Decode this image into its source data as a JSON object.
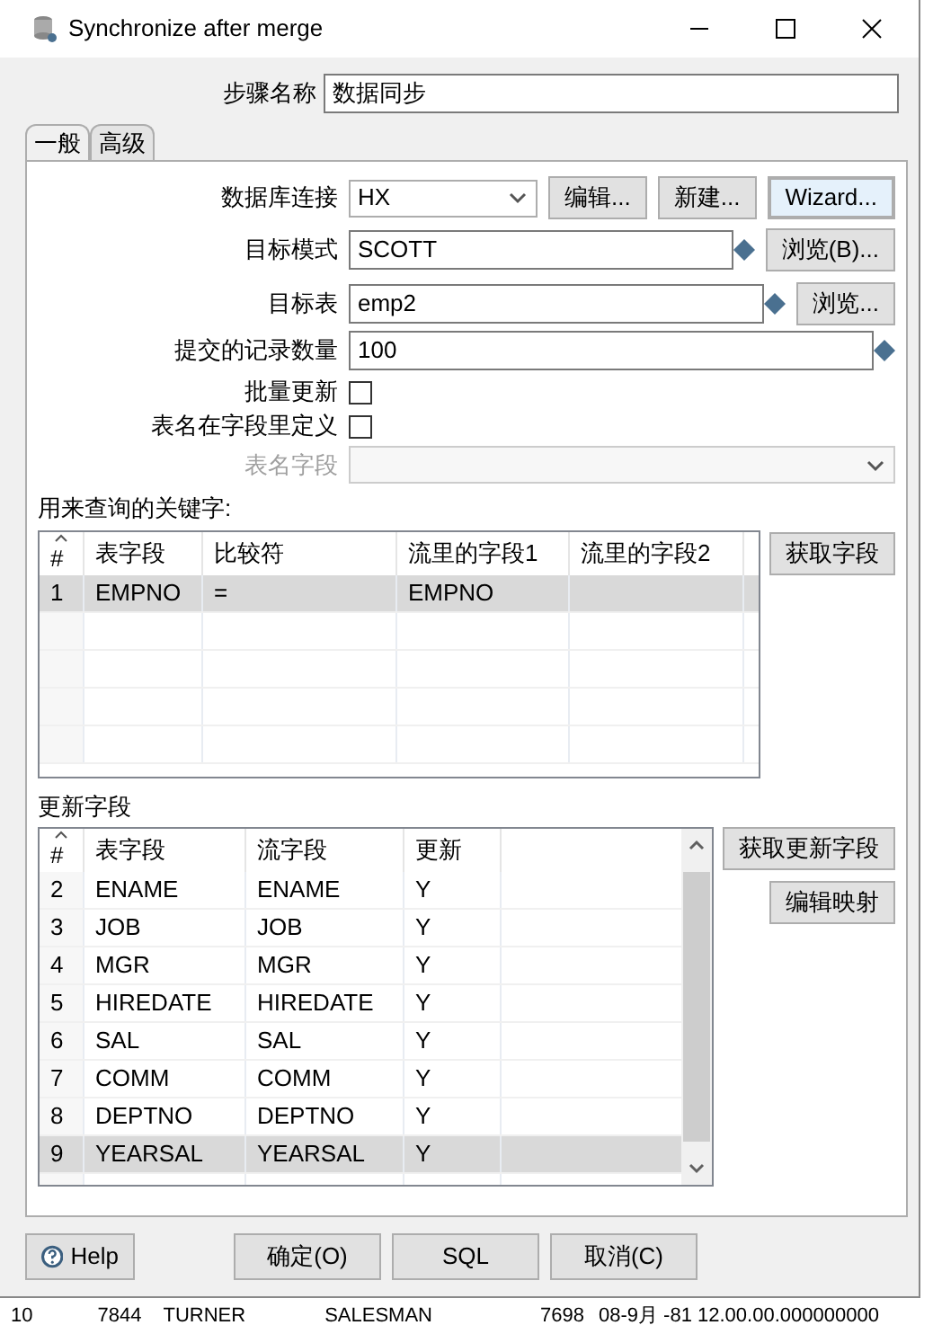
{
  "window": {
    "title": "Synchronize after merge"
  },
  "step_name": {
    "label": "步骤名称",
    "value": "数据同步"
  },
  "tabs": [
    {
      "label": "一般",
      "selected": true
    },
    {
      "label": "高级",
      "selected": false
    }
  ],
  "connection": {
    "label": "数据库连接",
    "value": "HX",
    "buttons": [
      {
        "label": "编辑...",
        "focused": false
      },
      {
        "label": "新建...",
        "focused": false
      },
      {
        "label": "Wizard...",
        "focused": true
      }
    ]
  },
  "target_schema": {
    "label": "目标模式",
    "value": "SCOTT",
    "button": "浏览(B)..."
  },
  "target_table": {
    "label": "目标表",
    "value": "emp2",
    "button": "浏览..."
  },
  "commit_size": {
    "label": "提交的记录数量",
    "value": "100"
  },
  "checkboxes": [
    {
      "label": "批量更新",
      "checked": false
    },
    {
      "label": "表名在字段里定义",
      "checked": false
    }
  ],
  "table_name_field": {
    "label": "表名字段",
    "disabled": true
  },
  "keys": {
    "label": "用来查询的关键字:",
    "columns": [
      "#",
      "表字段",
      "比较符",
      "流里的字段1",
      "流里的字段2"
    ],
    "rows": [
      {
        "cells": [
          "1",
          "EMPNO",
          "=",
          "EMPNO"
        ],
        "selected": true
      }
    ],
    "button": "获取字段"
  },
  "update_fields": {
    "label": "更新字段",
    "columns": [
      "#",
      "表字段",
      "流字段",
      "更新"
    ],
    "rows": [
      {
        "cells": [
          "2",
          "ENAME",
          "ENAME",
          "Y"
        ],
        "selected": false
      },
      {
        "cells": [
          "3",
          "JOB",
          "JOB",
          "Y"
        ],
        "selected": false
      },
      {
        "cells": [
          "4",
          "MGR",
          "MGR",
          "Y"
        ],
        "selected": false
      },
      {
        "cells": [
          "5",
          "HIREDATE",
          "HIREDATE",
          "Y"
        ],
        "selected": false
      },
      {
        "cells": [
          "6",
          "SAL",
          "SAL",
          "Y"
        ],
        "selected": false
      },
      {
        "cells": [
          "7",
          "COMM",
          "COMM",
          "Y"
        ],
        "selected": false
      },
      {
        "cells": [
          "8",
          "DEPTNO",
          "DEPTNO",
          "Y"
        ],
        "selected": false
      },
      {
        "cells": [
          "9",
          "YEARSAL",
          "YEARSAL",
          "Y"
        ],
        "selected": true
      }
    ],
    "buttons": [
      "获取更新字段",
      "编辑映射"
    ]
  },
  "footer_buttons": [
    {
      "label": "Help",
      "kind": "help"
    },
    {
      "label": "确定(O)",
      "kind": "plain"
    },
    {
      "label": "SQL",
      "kind": "plain"
    },
    {
      "label": "取消(C)",
      "kind": "plain"
    }
  ],
  "background_row": [
    "10",
    "7844",
    "TURNER",
    "SALESMAN",
    "7698",
    "08-9月 -81 12.00.00.000000000"
  ]
}
